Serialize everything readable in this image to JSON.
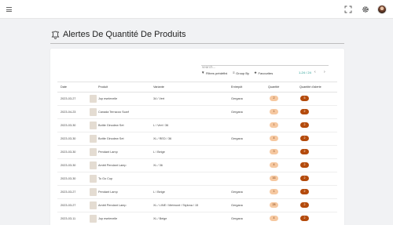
{
  "topbar": {
    "menu_icon": "hamburger-icon",
    "expand_icon": "expand-icon",
    "settings_icon": "gear-icon",
    "avatar_icon": "user-avatar"
  },
  "page": {
    "title": "Alertes De Quantité De Produits",
    "title_icon": "bell-icon"
  },
  "search": {
    "placeholder": "search..."
  },
  "toolbar": {
    "filters_label": "Filtres prédéfini",
    "groupby_label": "Group By",
    "favourites_label": "Favourites",
    "pager": "1-24 / 24"
  },
  "table": {
    "columns": [
      "Date",
      "Produit",
      "Variante",
      "Entrepôt",
      "Quantité",
      "Quantité d'alerte"
    ],
    "rows": [
      {
        "date": "2023-03-27",
        "product": "Jup eselenelle",
        "variant": "34 / Vert",
        "warehouse": "Gergana",
        "qty": "2",
        "alert": "5"
      },
      {
        "date": "2023-04-23",
        "product": "Canada Terracoo Scarf",
        "variant": "",
        "warehouse": "Gergana",
        "qty": "1",
        "alert": "2"
      },
      {
        "date": "2023-03-30",
        "product": "Bottle Ginodew Set",
        "variant": "L / Vert / 36",
        "warehouse": "",
        "qty": "1",
        "alert": "2"
      },
      {
        "date": "2023-03-30",
        "product": "Bottle Ginodew Set",
        "variant": "XL / RED / 36",
        "warehouse": "Gergana",
        "qty": "4",
        "alert": "2"
      },
      {
        "date": "2023-03-30",
        "product": "Pendant Lamp",
        "variant": "L / Beige",
        "warehouse": "",
        "qty": "3",
        "alert": "2"
      },
      {
        "date": "2023-03-30",
        "product": "Ambit Pendant Lamp",
        "variant": "XL / 36",
        "warehouse": "",
        "qty": "4",
        "alert": "2"
      },
      {
        "date": "2023-03-30",
        "product": "To Go Cup",
        "variant": "",
        "warehouse": "",
        "qty": "16",
        "alert": "2"
      },
      {
        "date": "2023-03-27",
        "product": "Pendant Lamp",
        "variant": "L / Beige",
        "warehouse": "Gergana",
        "qty": "1",
        "alert": "2"
      },
      {
        "date": "2023-03-27",
        "product": "Ambit Pendant Lamp",
        "variant": "XL / LINE / Metmont / Stylona / 15",
        "warehouse": "Gergana",
        "qty": "28",
        "alert": "2"
      },
      {
        "date": "2023-03-11",
        "product": "Jup eselenelle",
        "variant": "XL / Beige",
        "warehouse": "Gergana",
        "qty": "4",
        "alert": "2"
      }
    ]
  },
  "colors": {
    "qty_badge_bg": "#f6c8a0",
    "alert_badge_bg": "#b44a0b",
    "pager_accent": "#1a9a8f"
  }
}
